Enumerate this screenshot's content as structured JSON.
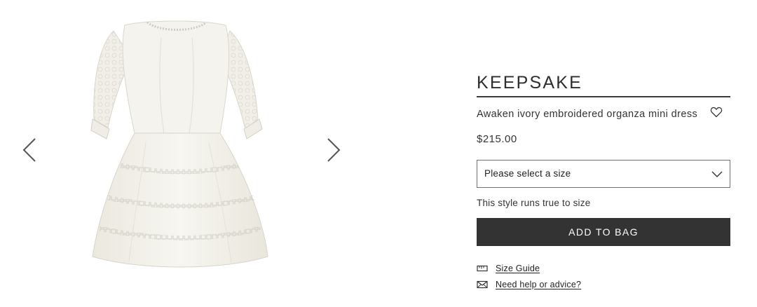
{
  "gallery": {
    "prev_icon": "chevron-left-icon",
    "next_icon": "chevron-right-icon",
    "image_alt": "Awaken ivory embroidered organza mini dress"
  },
  "product": {
    "brand": "KEEPSAKE",
    "name": "Awaken ivory embroidered organza mini dress",
    "wishlist_icon": "heart-icon",
    "price": "$215.00",
    "size_select": {
      "placeholder": "Please select a size",
      "icon": "chevron-down-icon"
    },
    "fit_note": "This style runs true to size",
    "add_to_bag_label": "ADD TO BAG"
  },
  "links": {
    "size_guide": {
      "label": "Size Guide",
      "icon": "ruler-icon"
    },
    "help": {
      "label": "Need help or advice?",
      "icon": "envelope-icon"
    }
  },
  "colors": {
    "primary_button": "#333333",
    "text": "#2b2b2b",
    "dress": "#f3f1ea"
  }
}
